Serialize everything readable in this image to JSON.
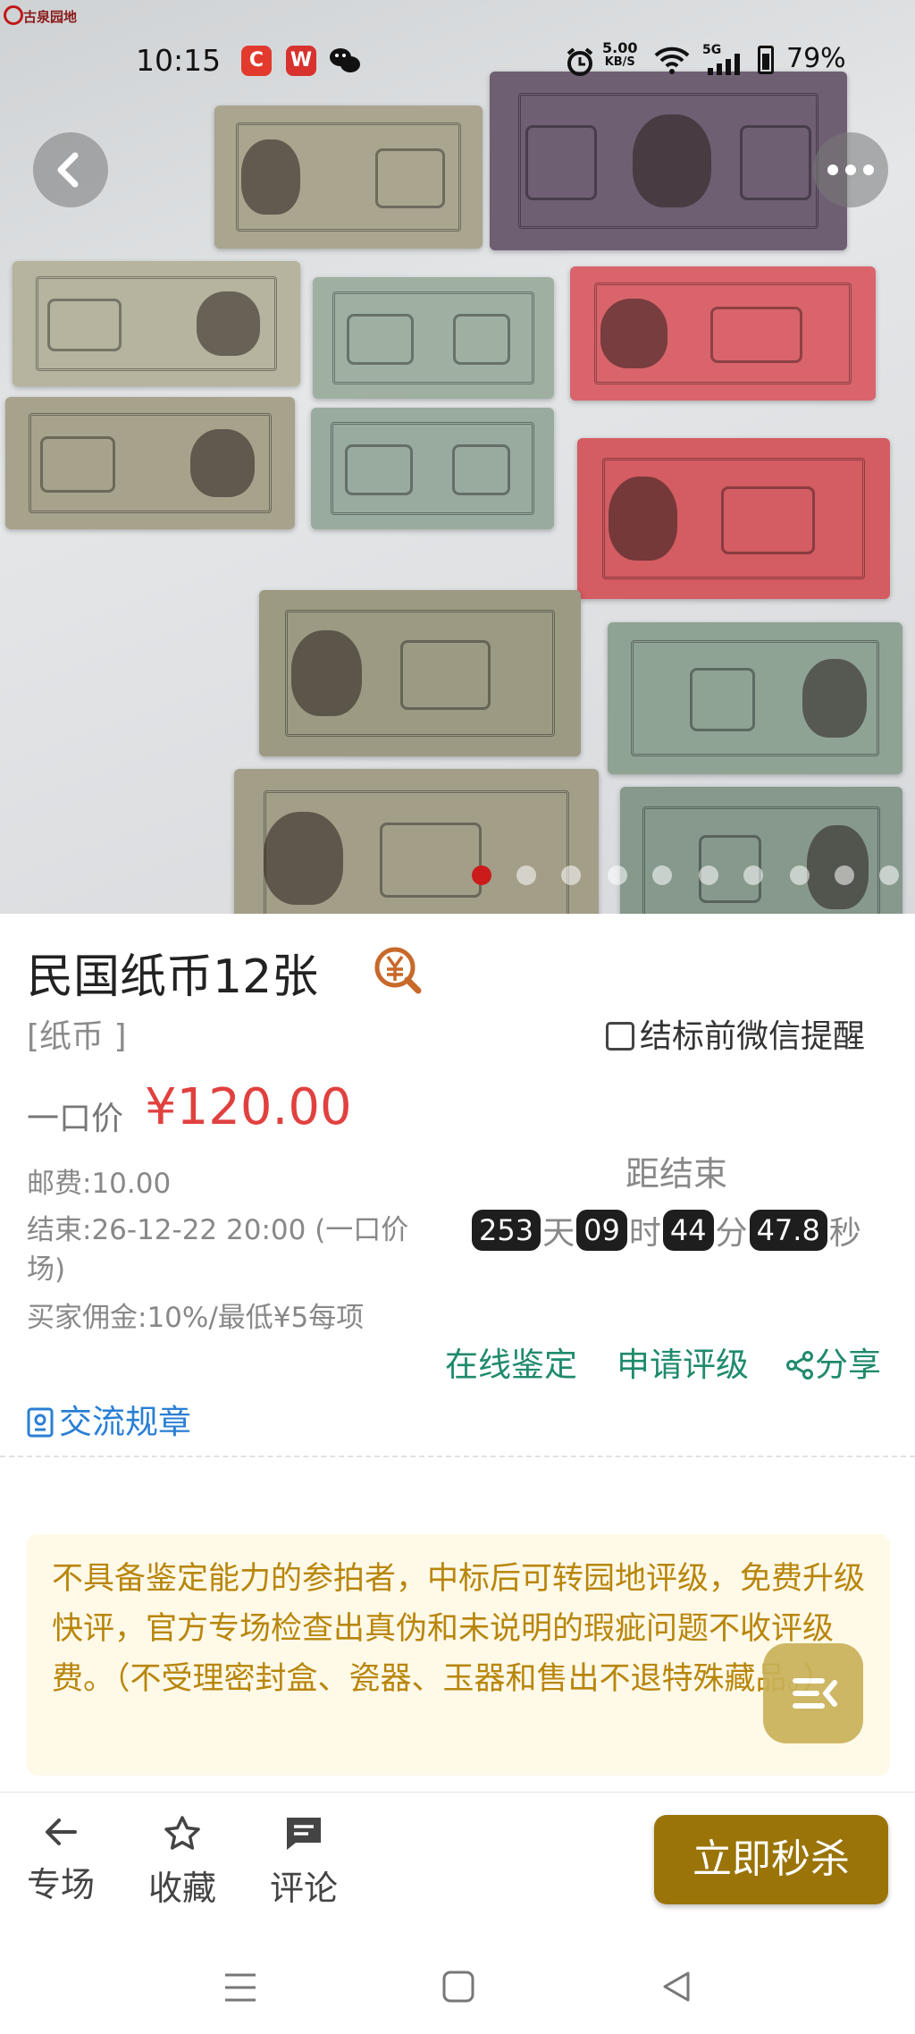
{
  "app": {
    "logo_text": "古泉园地"
  },
  "status_bar": {
    "time": "10:15",
    "apps": [
      "C",
      "W",
      "wechat"
    ],
    "net_speed": "5.00",
    "net_unit": "KB/S",
    "signal": "5G",
    "battery": "79%"
  },
  "gallery": {
    "image_count": 10,
    "active_index": 0
  },
  "item": {
    "title": "民国纸币12张",
    "category": "[纸币 ]",
    "remind_label": "结标前微信提醒",
    "price_label": "一口价",
    "price": "¥120.00",
    "shipping": "邮费:10.00",
    "end_line1": "结束:26-12-22 20:00 (一口价",
    "end_line2": "场)",
    "commission": "买家佣金:10%/最低¥5每项"
  },
  "countdown": {
    "label": "距结束",
    "days": "253",
    "days_unit": "天",
    "hours": "09",
    "hours_unit": "时",
    "minutes": "44",
    "minutes_unit": "分",
    "seconds": "47.8",
    "seconds_unit": "秒"
  },
  "actions": {
    "appraise": "在线鉴定",
    "grade": "申请评级",
    "share": "分享",
    "rules": "交流规章"
  },
  "notice": {
    "text": "不具备鉴定能力的参拍者，中标后可转园地评级，免费升级快评，官方专场检查出真伪和未说明的瑕疵问题不收评级费。（不受理密封盒、瓷器、玉器和售出不退特殊藏品。）"
  },
  "bottom_bar": {
    "venue": "专场",
    "favorite": "收藏",
    "comment": "评论",
    "buy_now": "立即秒杀"
  },
  "colors": {
    "price_red": "#e0413f",
    "action_green": "#1f8a6c",
    "link_blue": "#2a7fd4",
    "buy_gold": "#9a7408",
    "notice_bg": "#fff9e8",
    "notice_text": "#b8860b"
  }
}
